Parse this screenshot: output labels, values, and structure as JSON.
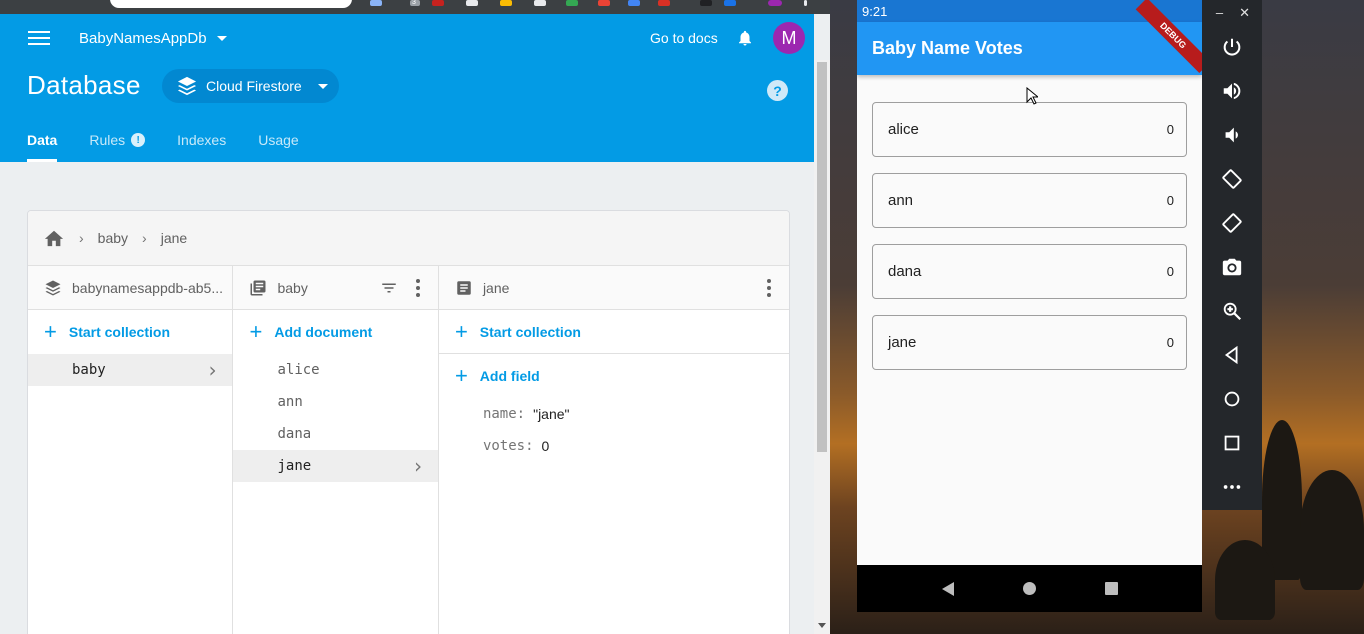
{
  "browser": {
    "project_name": "BabyNamesAppDb",
    "go_to_docs": "Go to docs",
    "avatar_initial": "M",
    "page_title": "Database",
    "db_type": "Cloud Firestore",
    "help_glyph": "?",
    "tabs": [
      {
        "label": "Data",
        "active": true
      },
      {
        "label": "Rules",
        "badge": "!"
      },
      {
        "label": "Indexes"
      },
      {
        "label": "Usage"
      }
    ],
    "extension_badge": "3",
    "breadcrumb": [
      "baby",
      "jane"
    ],
    "columns": {
      "root": {
        "title": "babynamesappdb-ab5...",
        "action": "Start collection",
        "items": [
          "baby"
        ]
      },
      "collection": {
        "title": "baby",
        "action": "Add document",
        "items": [
          "alice",
          "ann",
          "dana",
          "jane"
        ],
        "selected": "jane"
      },
      "document": {
        "title": "jane",
        "action_collection": "Start collection",
        "action_field": "Add field",
        "fields": [
          {
            "key": "name:",
            "value": "\"jane\""
          },
          {
            "key": "votes:",
            "value": "0"
          }
        ]
      }
    },
    "colors": {
      "header": "#039be5",
      "accent": "#039be5",
      "avatar": "#9c27b0"
    }
  },
  "phone": {
    "time": "9:21",
    "debug_banner": "DEBUG",
    "app_title": "Baby Name Votes",
    "votes": [
      {
        "name": "alice",
        "count": "0"
      },
      {
        "name": "ann",
        "count": "0"
      },
      {
        "name": "dana",
        "count": "0"
      },
      {
        "name": "jane",
        "count": "0"
      }
    ],
    "colors": {
      "appbar": "#2196f3",
      "statusbar": "#1976d2"
    }
  },
  "emulator": {
    "minimize": "–",
    "close": "✕",
    "tools": [
      "power-icon",
      "volume-up-icon",
      "volume-down-icon",
      "rotate-left-icon",
      "rotate-right-icon",
      "camera-icon",
      "zoom-icon",
      "back-icon",
      "home-icon",
      "overview-icon",
      "more-icon"
    ]
  }
}
